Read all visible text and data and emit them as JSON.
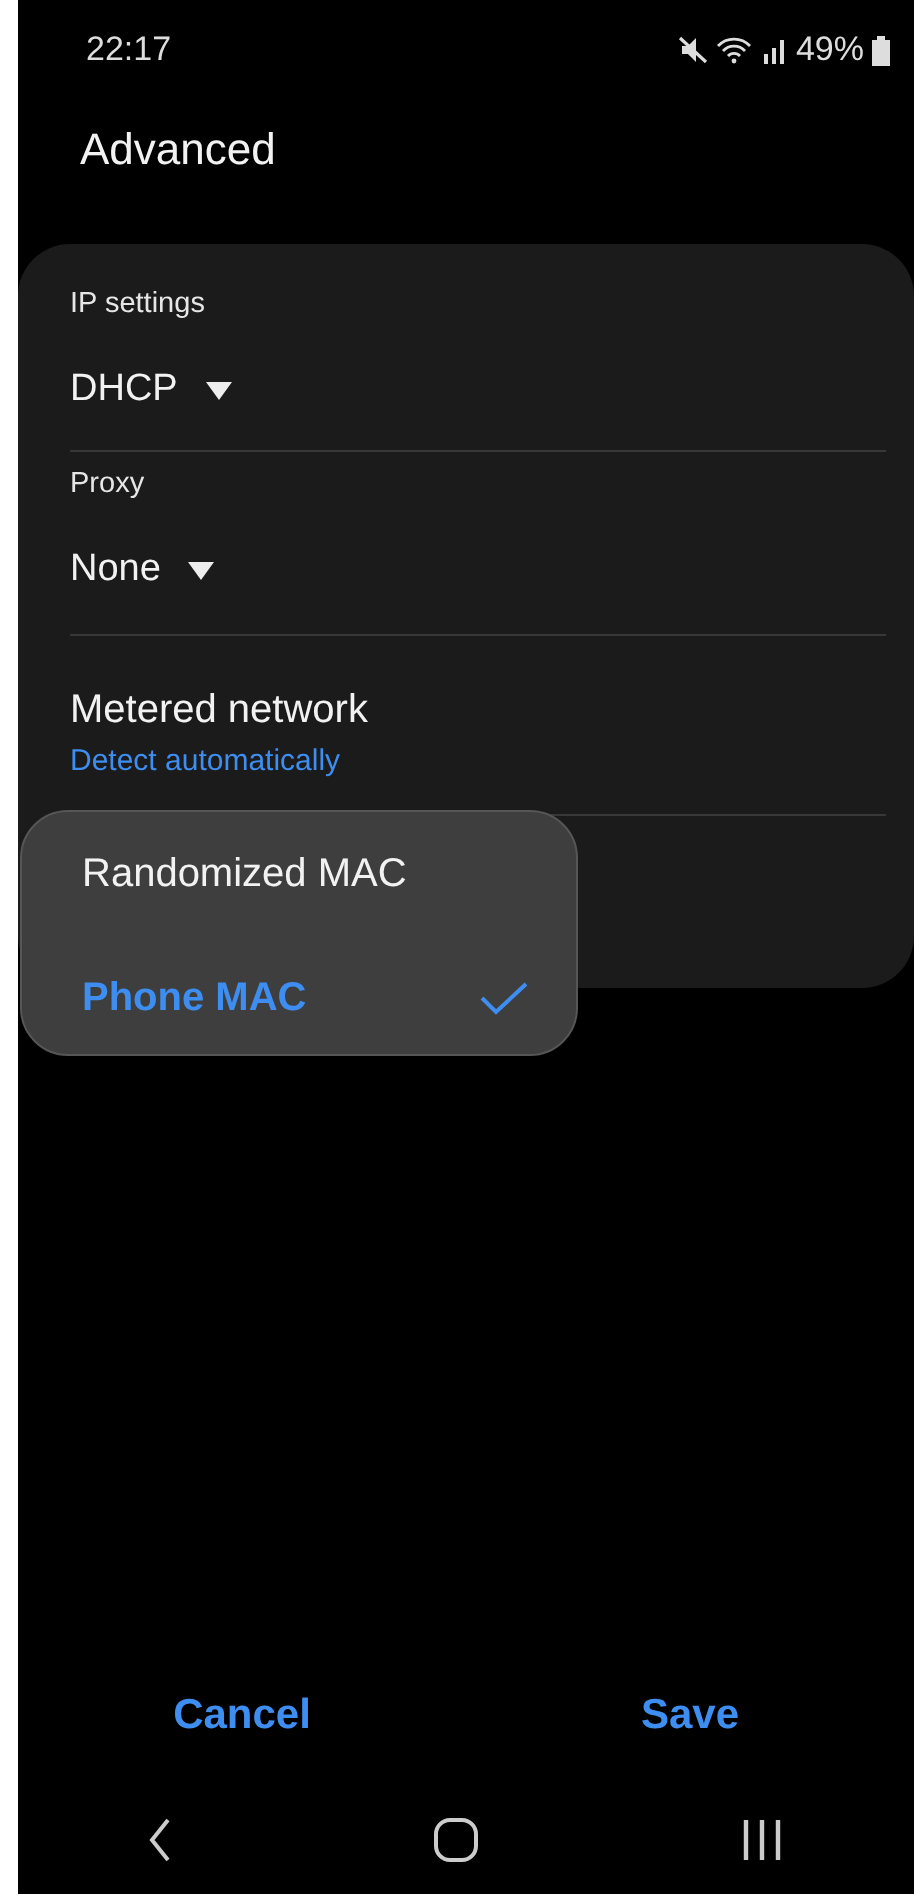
{
  "status_bar": {
    "time": "22:17",
    "battery": "49%"
  },
  "title": "Advanced",
  "settings": [
    {
      "kind": "dropdown",
      "label": "IP settings",
      "value": "DHCP"
    },
    {
      "kind": "dropdown",
      "label": "Proxy",
      "value": "None"
    },
    {
      "kind": "summary",
      "title": "Metered network",
      "summary": "Detect automatically"
    }
  ],
  "menu": [
    {
      "label": "Randomized MAC",
      "selected": false
    },
    {
      "label": "Phone MAC",
      "selected": true
    }
  ],
  "buttons": [
    "Cancel",
    "Save"
  ]
}
